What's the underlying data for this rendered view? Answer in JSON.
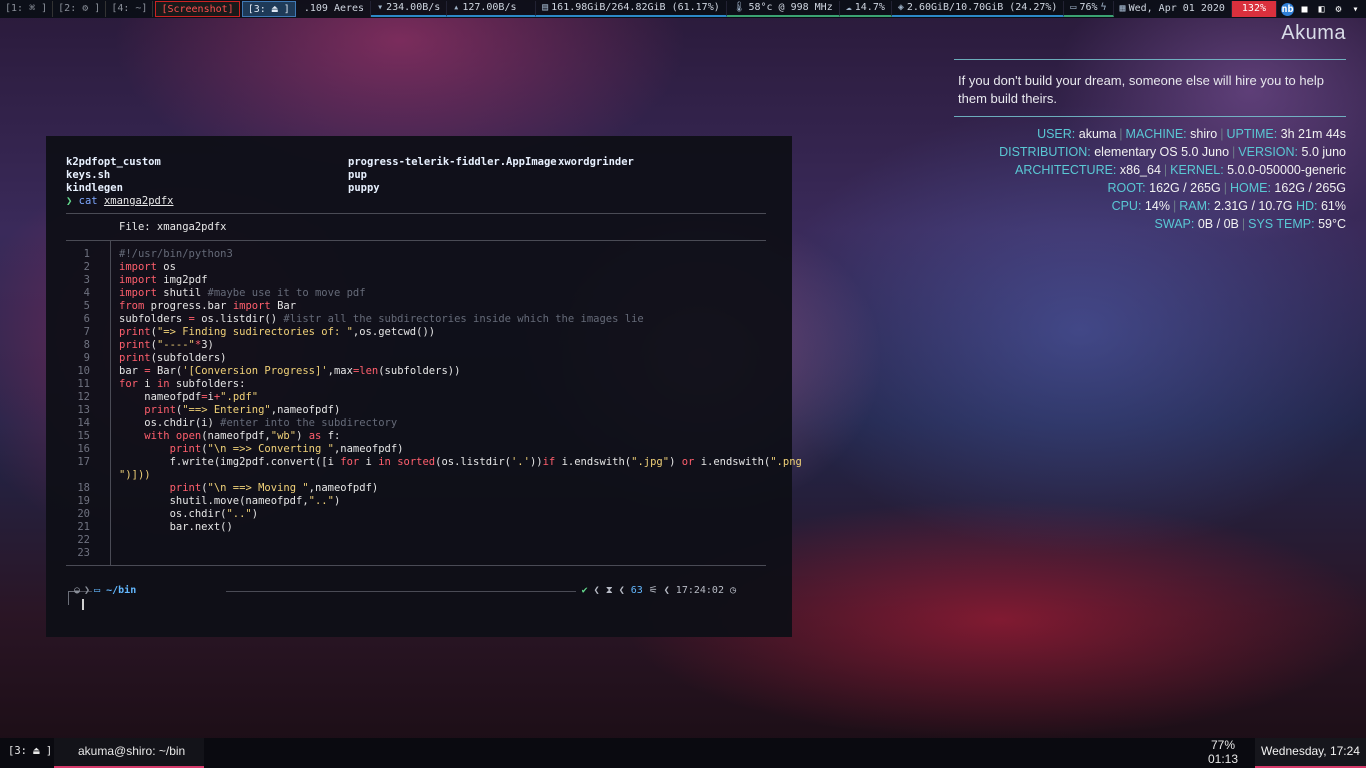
{
  "topbar": {
    "workspaces": [
      "[1: ⌘ ]",
      "[2: ⚙ ]",
      "[4: ~]"
    ],
    "screenshot_label": "[Screenshot]",
    "active_ws": "[3: ⏏ ]",
    "net_name": ".109 Aeres",
    "down_speed": "234.00B/s",
    "up_speed": "127.00B/s",
    "disk": "161.98GiB/264.82GiB (61.17%)",
    "cpu_temp": "58°c @ 998 MHz",
    "cpu_load": "14.7%",
    "ram": "2.60GiB/10.70GiB (24.27%)",
    "battery": "76%",
    "date": "Wed, Apr 01 2020",
    "volume": "132%",
    "tray_icons": [
      "nb",
      "■",
      "◧",
      "⚙",
      "▾"
    ]
  },
  "conky": {
    "hostname": "Akuma",
    "quote": "If you don't build your dream, someone else will hire you to help them build theirs.",
    "user_label": "USER:",
    "user": "akuma",
    "machine_label": "MACHINE:",
    "machine": "shiro",
    "uptime_label": "UPTIME:",
    "uptime": "3h 21m 44s",
    "distro_label": "DISTRIBUTION:",
    "distro": "elementary OS 5.0 Juno",
    "version_label": "VERSION:",
    "version": "5.0 juno",
    "arch_label": "ARCHITECTURE:",
    "arch": "x86_64",
    "kernel_label": "KERNEL:",
    "kernel": "5.0.0-050000-generic",
    "root_label": "ROOT:",
    "root": "162G / 265G",
    "home_label": "HOME:",
    "home": "162G / 265G",
    "cpu_label": "CPU:",
    "cpu": "14%",
    "ram_label": "RAM:",
    "ram": "2.31G / 10.7G",
    "hd_label": "HD:",
    "hd": "61%",
    "swap_label": "SWAP:",
    "swap": "0B / 0B",
    "systemp_label": "SYS TEMP:",
    "systemp": "59°C"
  },
  "terminal": {
    "ls": [
      [
        "k2pdfopt_custom",
        "progress-telerik-fiddler.AppImage",
        "xwordgrinder"
      ],
      [
        "keys.sh",
        "pup",
        ""
      ],
      [
        "kindlegen",
        "puppy",
        ""
      ]
    ],
    "prompt": "❯",
    "command": "cat",
    "argument": "xmanga2pdfx",
    "file_header": "File: xmanga2pdfx",
    "line_numbers": [
      "1",
      "2",
      "3",
      "4",
      "5",
      "6",
      "7",
      "8",
      "9",
      "10",
      "11",
      "12",
      "13",
      "14",
      "15",
      "16",
      "17",
      "",
      "18",
      "19",
      "20",
      "21",
      "22",
      "23"
    ],
    "code": [
      "#!/usr/bin/python3",
      "import os",
      "import img2pdf",
      "import shutil #maybe use it to move pdf",
      "from progress.bar import Bar",
      "subfolders = os.listdir() #listr all the subdirectories inside which the images lie",
      "print(\"=> Finding sudirectories of: \",os.getcwd())",
      "print(\"----\"*3)",
      "print(subfolders)",
      "bar = Bar('[Conversion Progress]',max=len(subfolders))",
      "for i in subfolders:",
      "    nameofpdf=i+\".pdf\"",
      "    print(\"==> Entering\",nameofpdf)",
      "    os.chdir(i) #enter into the subdirectory",
      "    with open(nameofpdf,\"wb\") as f:",
      "        print(\"\\n =>> Converting \",nameofpdf)",
      "        f.write(img2pdf.convert([i for i in sorted(os.listdir('.'))if i.endswith(\".jpg\") or i.endswith(\".png",
      "\")]))",
      "        print(\"\\n ==> Moving \",nameofpdf)",
      "        shutil.move(nameofpdf,\"..\")",
      "        os.chdir(\"..\")",
      "        bar.next()",
      "",
      ""
    ],
    "prompt_dir": "~/bin",
    "status_ok": "✔",
    "status_count": "63",
    "status_time": "17:24:02"
  },
  "taskbar": {
    "workspace": "[3: ⏏ ]",
    "task_title": "akuma@shiro: ~/bin",
    "battery_pct": "77%",
    "battery_time": "01:13",
    "clock": "Wednesday, 17:24"
  },
  "colors": {
    "accent_pink": "#d63a6b",
    "conky_key": "#5ac8d4",
    "volume_red": "#d9303d"
  }
}
